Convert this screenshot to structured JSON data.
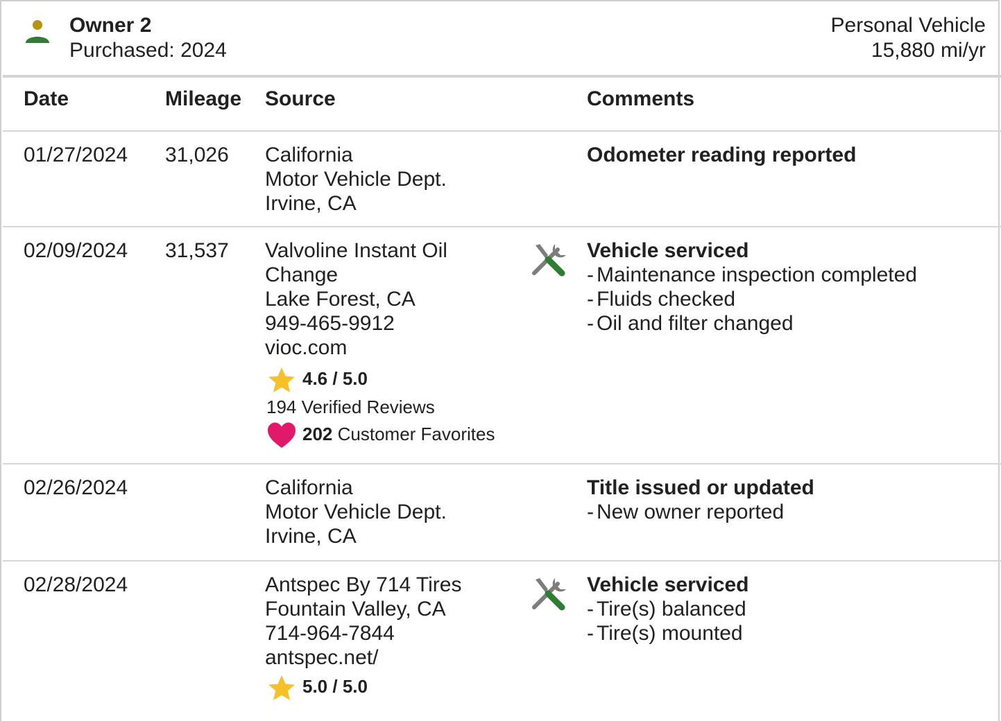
{
  "owner": {
    "name": "Owner 2",
    "purchased": "Purchased: 2024",
    "vehicle_type": "Personal Vehicle",
    "usage": "15,880 mi/yr",
    "icon_colors": {
      "head": "#b8930f",
      "body": "#2e7d32"
    }
  },
  "columns": {
    "date": "Date",
    "mileage": "Mileage",
    "source": "Source",
    "comments": "Comments"
  },
  "records": [
    {
      "date": "01/27/2024",
      "mileage": "31,026",
      "source": [
        "California",
        "Motor Vehicle Dept.",
        "Irvine, CA"
      ],
      "icon": "",
      "comment_title": "Odometer reading reported",
      "details": []
    },
    {
      "date": "02/09/2024",
      "mileage": "31,537",
      "source": [
        "Valvoline Instant Oil",
        "Change",
        "Lake Forest, CA",
        "949-465-9912",
        "vioc.com"
      ],
      "rating": "4.6 / 5.0",
      "reviews": "194 Verified Reviews",
      "favorites_count": "202",
      "favorites_label": " Customer Favorites",
      "icon": "tools-icon",
      "comment_title": "Vehicle serviced",
      "details": [
        "Maintenance inspection completed",
        "Fluids checked",
        "Oil and filter changed"
      ]
    },
    {
      "date": "02/26/2024",
      "mileage": "",
      "source": [
        "California",
        "Motor Vehicle Dept.",
        "Irvine, CA"
      ],
      "icon": "",
      "comment_title": "Title issued or updated",
      "details": [
        "New owner reported"
      ]
    },
    {
      "date": "02/28/2024",
      "mileage": "",
      "source": [
        "Antspec By 714 Tires",
        "Fountain Valley, CA",
        "714-964-7844",
        "antspec.net/"
      ],
      "rating": "5.0 / 5.0",
      "icon": "tools-icon",
      "comment_title": "Vehicle serviced",
      "details": [
        "Tire(s) balanced",
        "Tire(s) mounted"
      ]
    }
  ],
  "colors": {
    "star": "#f6c029",
    "heart": "#e0196b",
    "tool_gray": "#7d7d7d",
    "tool_green": "#2e7d32",
    "divider": "#d6d6d6"
  }
}
